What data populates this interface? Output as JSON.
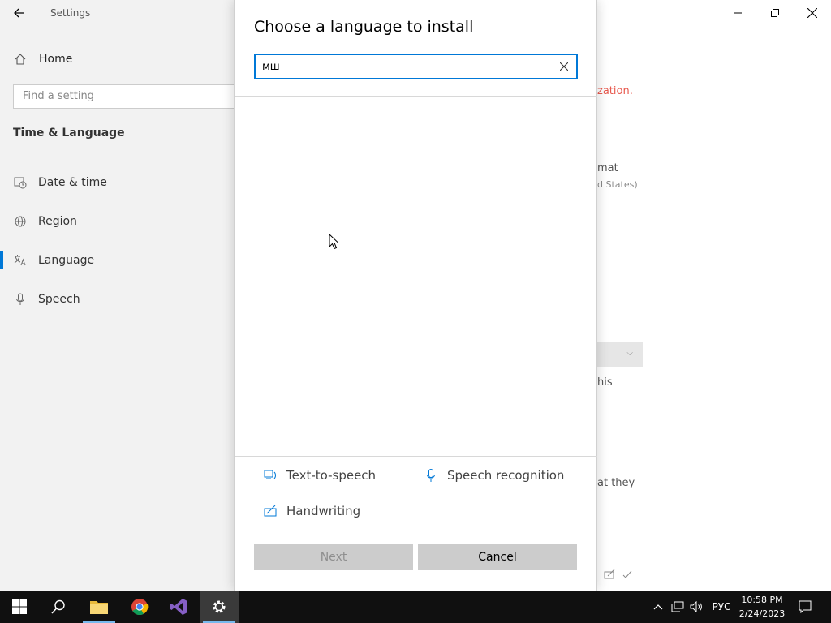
{
  "settings": {
    "window_title": "Settings",
    "home_label": "Home",
    "find_placeholder": "Find a setting",
    "section_title": "Time & Language",
    "nav_items": [
      {
        "label": "Date & time",
        "icon": "clock-calendar-icon"
      },
      {
        "label": "Region",
        "icon": "globe-icon"
      },
      {
        "label": "Language",
        "icon": "language-icon",
        "selected": true
      },
      {
        "label": "Speech",
        "icon": "microphone-icon"
      }
    ],
    "background_fragments": {
      "warning": "zation.",
      "format_label": "mat",
      "format_value": "d States)",
      "this_text": "his",
      "they_text": "at they"
    }
  },
  "dialog": {
    "title": "Choose a language to install",
    "search_value": "мш",
    "features": {
      "tts": "Text-to-speech",
      "speech": "Speech recognition",
      "handwriting": "Handwriting"
    },
    "next_label": "Next",
    "cancel_label": "Cancel"
  },
  "taskbar": {
    "language": "РУС",
    "time": "10:58 PM",
    "date": "2/24/2023"
  },
  "colors": {
    "accent": "#0078d7",
    "warning": "#e85a4f",
    "taskbar": "#101010"
  }
}
